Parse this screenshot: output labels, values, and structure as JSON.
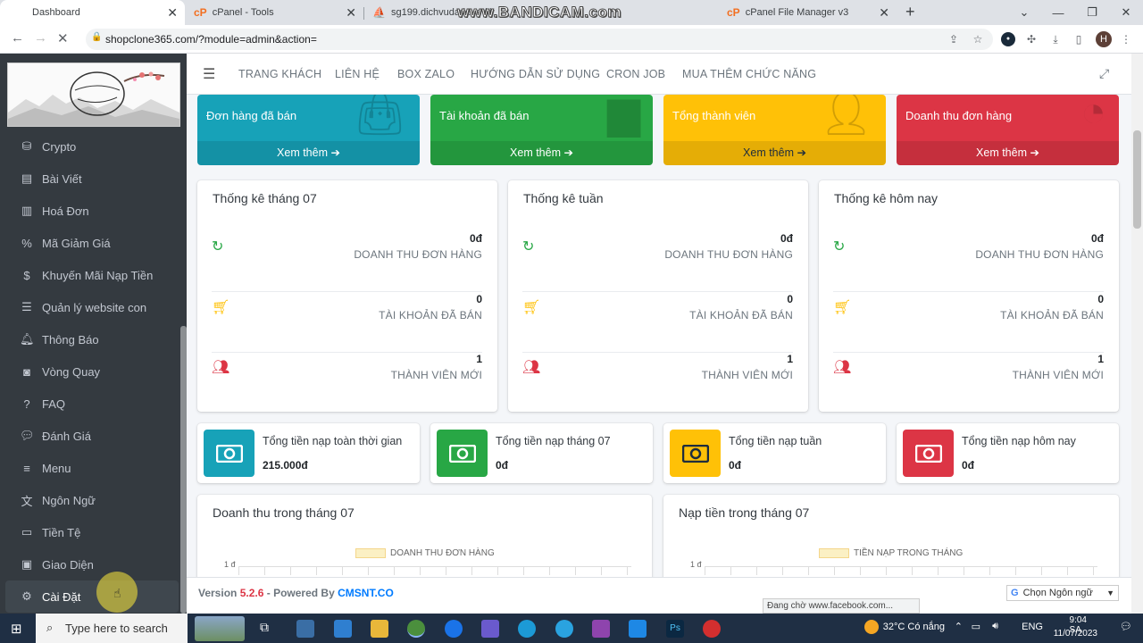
{
  "browser": {
    "tabs": [
      {
        "title": "Dashboard",
        "active": true
      },
      {
        "title": "cPanel - Tools",
        "active": false
      },
      {
        "title": "sg199.dichvudark.vn / l",
        "active": false
      },
      {
        "title": "cPanel File Manager v3",
        "active": false
      }
    ],
    "watermark": "www.BANDICAM.com",
    "url": "shopclone365.com/?module=admin&action=",
    "profile_initial": "H"
  },
  "sidebar": {
    "items": [
      {
        "label": "Crypto",
        "icon": "coins-icon"
      },
      {
        "label": "Bài Viết",
        "icon": "file-icon"
      },
      {
        "label": "Hoá Đơn",
        "icon": "invoice-icon"
      },
      {
        "label": "Mã Giảm Giá",
        "icon": "percent-icon"
      },
      {
        "label": "Khuyến Mãi Nạp Tiền",
        "icon": "dollar-icon"
      },
      {
        "label": "Quản lý website con",
        "icon": "list-icon"
      },
      {
        "label": "Thông Báo",
        "icon": "bell-icon"
      },
      {
        "label": "Vòng Quay",
        "icon": "gamepad-icon"
      },
      {
        "label": "FAQ",
        "icon": "question-icon"
      },
      {
        "label": "Đánh Giá",
        "icon": "comment-icon"
      },
      {
        "label": "Menu",
        "icon": "bars-icon"
      },
      {
        "label": "Ngôn Ngữ",
        "icon": "language-icon"
      },
      {
        "label": "Tiền Tệ",
        "icon": "money-icon"
      },
      {
        "label": "Giao Diện",
        "icon": "image-icon"
      },
      {
        "label": "Cài Đặt",
        "icon": "gear-icon",
        "active": true
      }
    ]
  },
  "topnav": {
    "links": [
      "TRANG KHÁCH",
      "LIÊN HỆ",
      "BOX ZALO",
      "HƯỚNG DẪN SỬ DỤNG",
      "CRON JOB",
      "MUA THÊM CHỨC NĂNG"
    ]
  },
  "stat_boxes": [
    {
      "label": "Đơn hàng đã bán",
      "more": "Xem thêm",
      "color": "#17a2b8"
    },
    {
      "label": "Tài khoản đã bán",
      "more": "Xem thêm",
      "color": "#28a745"
    },
    {
      "label": "Tổng thành viên",
      "more": "Xem thêm",
      "color": "#ffc107"
    },
    {
      "label": "Doanh thu đơn hàng",
      "more": "Xem thêm",
      "color": "#dc3545"
    }
  ],
  "stat_cards": [
    {
      "title": "Thống kê tháng 07",
      "rows": [
        {
          "value": "0đ",
          "label": "DOANH THU ĐƠN HÀNG"
        },
        {
          "value": "0",
          "label": "TÀI KHOẢN ĐÃ BÁN"
        },
        {
          "value": "1",
          "label": "THÀNH VIÊN MỚI"
        }
      ]
    },
    {
      "title": "Thống kê tuần",
      "rows": [
        {
          "value": "0đ",
          "label": "DOANH THU ĐƠN HÀNG"
        },
        {
          "value": "0",
          "label": "TÀI KHOẢN ĐÃ BÁN"
        },
        {
          "value": "1",
          "label": "THÀNH VIÊN MỚI"
        }
      ]
    },
    {
      "title": "Thống kê hôm nay",
      "rows": [
        {
          "value": "0đ",
          "label": "DOANH THU ĐƠN HÀNG"
        },
        {
          "value": "0",
          "label": "TÀI KHOẢN ĐÃ BÁN"
        },
        {
          "value": "1",
          "label": "THÀNH VIÊN MỚI"
        }
      ]
    }
  ],
  "topup_boxes": [
    {
      "title": "Tổng tiền nạp toàn thời gian",
      "value": "215.000đ",
      "color": "#17a2b8"
    },
    {
      "title": "Tổng tiền nạp tháng 07",
      "value": "0đ",
      "color": "#28a745"
    },
    {
      "title": "Tổng tiền nạp tuần",
      "value": "0đ",
      "color": "#ffc107"
    },
    {
      "title": "Tổng tiền nạp hôm nay",
      "value": "0đ",
      "color": "#dc3545"
    }
  ],
  "charts": [
    {
      "title": "Doanh thu trong tháng 07",
      "legend": "DOANH THU ĐƠN HÀNG",
      "y_tick": "1 đ"
    },
    {
      "title": "Nạp tiền trong tháng 07",
      "legend": "TIỀN NẠP TRONG THÁNG",
      "y_tick": "1 đ"
    }
  ],
  "footer": {
    "version_label": "Version",
    "version": "5.2.6",
    "powered_label": "- Powered By",
    "brand": "CMSNT.CO",
    "lang_select": "Chọn Ngôn ngữ"
  },
  "status_tip": "Đang chờ www.facebook.com...",
  "taskbar": {
    "search_placeholder": "Type here to search",
    "weather": "32°C  Có nắng",
    "lang": "ENG",
    "time": "9:04 SA",
    "date": "11/07/2023"
  }
}
